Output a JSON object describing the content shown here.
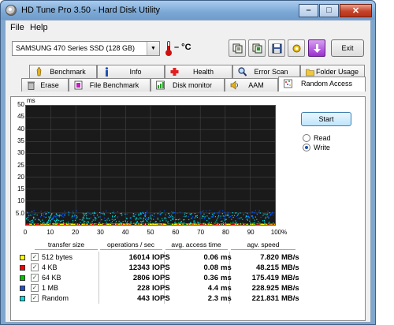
{
  "window": {
    "title": "HD Tune Pro 3.50 - Hard Disk Utility",
    "buttons": {
      "minimize": "–",
      "maximize": "□",
      "close": "✕"
    }
  },
  "menu": [
    {
      "label": "File"
    },
    {
      "label": "Help"
    }
  ],
  "toolbar": {
    "drive": "SAMSUNG 470 Series SSD (128 GB)",
    "temperature": "– °C",
    "exit_label": "Exit",
    "icons": [
      "copy-text-icon",
      "copy-info-icon",
      "save-icon",
      "options-icon",
      "download-icon"
    ]
  },
  "tabs": {
    "row1": [
      {
        "label": "Benchmark",
        "icon": "benchmark-icon"
      },
      {
        "label": "Info",
        "icon": "info-icon"
      },
      {
        "label": "Health",
        "icon": "health-icon"
      },
      {
        "label": "Error Scan",
        "icon": "error-scan-icon"
      },
      {
        "label": "Folder Usage",
        "icon": "folder-icon"
      }
    ],
    "row2": [
      {
        "label": "Erase",
        "icon": "erase-icon"
      },
      {
        "label": "File Benchmark",
        "icon": "file-benchmark-icon"
      },
      {
        "label": "Disk monitor",
        "icon": "disk-monitor-icon"
      },
      {
        "label": "AAM",
        "icon": "aam-icon"
      },
      {
        "label": "Random Access",
        "icon": "random-access-icon"
      }
    ],
    "active": "Random Access"
  },
  "controls": {
    "start_label": "Start",
    "read_label": "Read",
    "write_label": "Write",
    "mode": "Write"
  },
  "chart_data": {
    "type": "scatter",
    "title": "",
    "ylabel": "ms",
    "xlabel": "",
    "x_unit": "%",
    "ylim": [
      0,
      50
    ],
    "xlim": [
      0,
      100
    ],
    "y_ticks": [
      "50",
      "45",
      "40",
      "35",
      "30",
      "25",
      "20",
      "15",
      "10",
      "5.0"
    ],
    "x_ticks": [
      "0",
      "10",
      "20",
      "30",
      "40",
      "50",
      "60",
      "70",
      "80",
      "90",
      "100%"
    ],
    "grid": true,
    "series": [
      {
        "color": "#ffff00",
        "y_range": [
          0.0,
          0.2
        ]
      },
      {
        "color": "#ff0000",
        "y_range": [
          0.0,
          0.3
        ]
      },
      {
        "color": "#00c000",
        "y_range": [
          0.1,
          0.6
        ]
      },
      {
        "color": "#0050ff",
        "y_range": [
          2.5,
          6.0
        ]
      },
      {
        "color": "#00e0e0",
        "y_range": [
          0.1,
          5.0
        ]
      }
    ]
  },
  "table": {
    "headers": [
      "transfer size",
      "operations / sec",
      "avg. access time",
      "agv. speed"
    ],
    "rows": [
      {
        "color": "#ffff00",
        "name": "512 bytes",
        "ops": "16014",
        "ops_unit": "IOPS",
        "access": "0.06",
        "access_unit": "ms",
        "speed": "7.820",
        "speed_unit": "MB/s"
      },
      {
        "color": "#ff0000",
        "name": "4 KB",
        "ops": "12343",
        "ops_unit": "IOPS",
        "access": "0.08",
        "access_unit": "ms",
        "speed": "48.215",
        "speed_unit": "MB/s"
      },
      {
        "color": "#00c000",
        "name": "64 KB",
        "ops": "2806",
        "ops_unit": "IOPS",
        "access": "0.36",
        "access_unit": "ms",
        "speed": "175.419",
        "speed_unit": "MB/s"
      },
      {
        "color": "#1e50d0",
        "name": "1 MB",
        "ops": "228",
        "ops_unit": "IOPS",
        "access": "4.4",
        "access_unit": "ms",
        "speed": "228.925",
        "speed_unit": "MB/s"
      },
      {
        "color": "#00e0e0",
        "name": "Random",
        "ops": "443",
        "ops_unit": "IOPS",
        "access": "2.3",
        "access_unit": "ms",
        "speed": "221.831",
        "speed_unit": "MB/s"
      }
    ]
  }
}
